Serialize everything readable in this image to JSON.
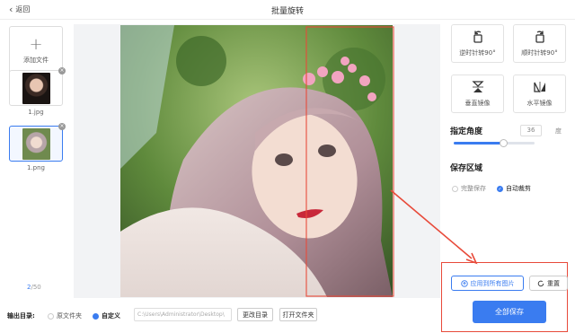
{
  "header": {
    "back_label": "返回",
    "title": "批量旋转"
  },
  "sidebar": {
    "add_file_label": "添加文件",
    "files": [
      {
        "name": "1.jpg"
      },
      {
        "name": "1.png"
      }
    ],
    "pager_current": "2",
    "pager_total": "/50"
  },
  "tools": [
    {
      "label": "逆时针转90°",
      "icon": "rotate-ccw-icon"
    },
    {
      "label": "顺时针转90°",
      "icon": "rotate-cw-icon"
    },
    {
      "label": "垂直镜像",
      "icon": "flip-vertical-icon"
    },
    {
      "label": "水平镜像",
      "icon": "flip-horizontal-icon"
    }
  ],
  "angle": {
    "title": "指定角度",
    "value": "36",
    "unit": "度",
    "slider_level": 0.62
  },
  "save_region": {
    "title": "保存区域",
    "options": [
      {
        "label": "完整保存",
        "checked": false
      },
      {
        "label": "自动裁剪",
        "checked": true
      }
    ]
  },
  "actions": {
    "apply_all_label": "应用到所有图片",
    "reset_label": "重置",
    "save_all_label": "全部保存"
  },
  "output": {
    "label": "输出目录:",
    "original_folder_label": "原文件夹",
    "custom_label": "自定义",
    "path": "C:\\Users\\Administrator\\Desktop\\",
    "change_dir_label": "更改目录",
    "open_folder_label": "打开文件夹"
  },
  "colors": {
    "accent": "#3a7cf0",
    "annotation": "#e84a3a"
  }
}
